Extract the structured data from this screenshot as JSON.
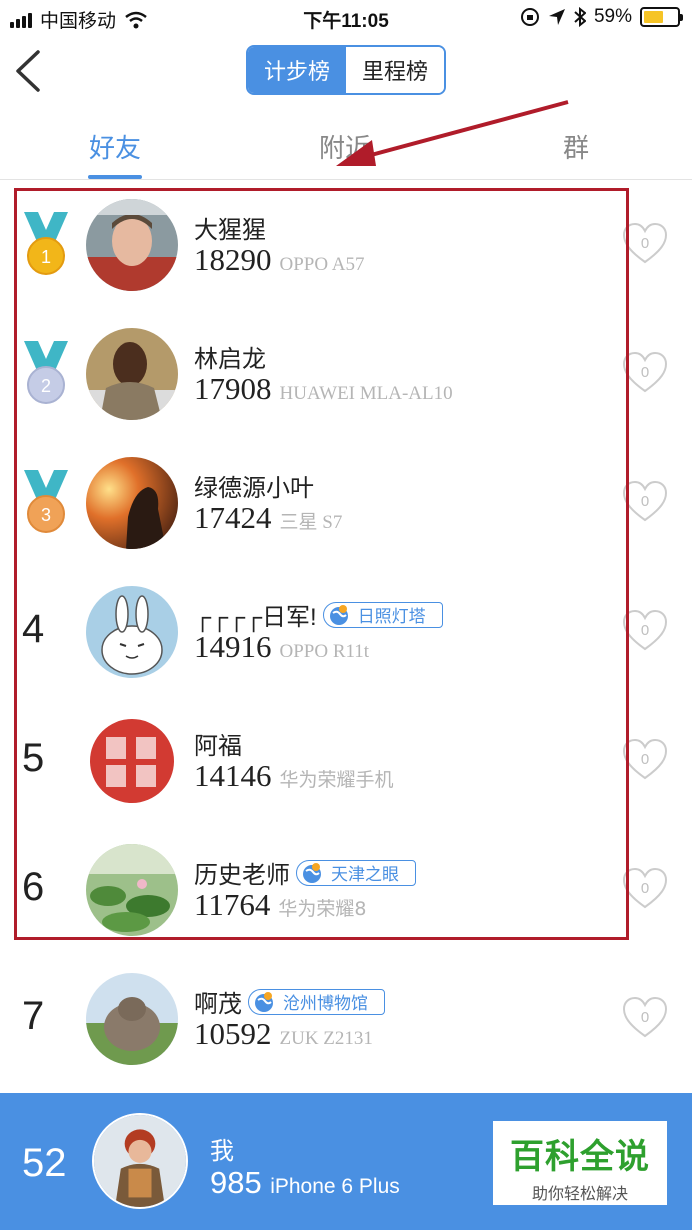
{
  "status": {
    "carrier": "中国移动",
    "time": "下午11:05",
    "battery": "59%",
    "battery_level": 0.59
  },
  "nav": {
    "tabs_segment": [
      "计步榜",
      "里程榜"
    ],
    "active_segment": 0
  },
  "tabs": [
    "好友",
    "附近",
    "群"
  ],
  "active_tab": 0,
  "rows": [
    {
      "rank": "1",
      "medal": true,
      "name": "大猩猩",
      "location": "",
      "steps": "18290",
      "device": "OPPO A57",
      "likes": "0"
    },
    {
      "rank": "2",
      "medal": true,
      "name": "林启龙",
      "location": "",
      "steps": "17908",
      "device": "HUAWEI MLA-AL10",
      "likes": "0"
    },
    {
      "rank": "3",
      "medal": true,
      "name": "绿德源小叶",
      "location": "",
      "steps": "17424",
      "device": "三星 S7",
      "likes": "0"
    },
    {
      "rank": "4",
      "medal": false,
      "name": "┌┌┌┌日军!",
      "location": "日照灯塔",
      "steps": "14916",
      "device": "OPPO R11t",
      "likes": "0"
    },
    {
      "rank": "5",
      "medal": false,
      "name": "阿福",
      "location": "",
      "steps": "14146",
      "device": "华为荣耀手机",
      "likes": "0"
    },
    {
      "rank": "6",
      "medal": false,
      "name": "历史老师",
      "location": "天津之眼",
      "steps": "11764",
      "device": "华为荣耀8",
      "likes": "0"
    },
    {
      "rank": "7",
      "medal": false,
      "name": "啊茂",
      "location": "沧州博物馆",
      "steps": "10592",
      "device": "ZUK Z2131",
      "likes": "0"
    }
  ],
  "me": {
    "rank": "52",
    "name": "我",
    "steps": "985",
    "device": "iPhone 6 Plus"
  },
  "watermark": {
    "title": "百科全说",
    "subtitle": "助你轻松解决"
  },
  "colors": {
    "accent": "#4a90e2",
    "highlight": "#b01c2a",
    "medal_gold": "#f2b619",
    "medal_silver": "#b9c2e0",
    "medal_bronze": "#f0a257",
    "ribbon": "#3fb6c6"
  }
}
